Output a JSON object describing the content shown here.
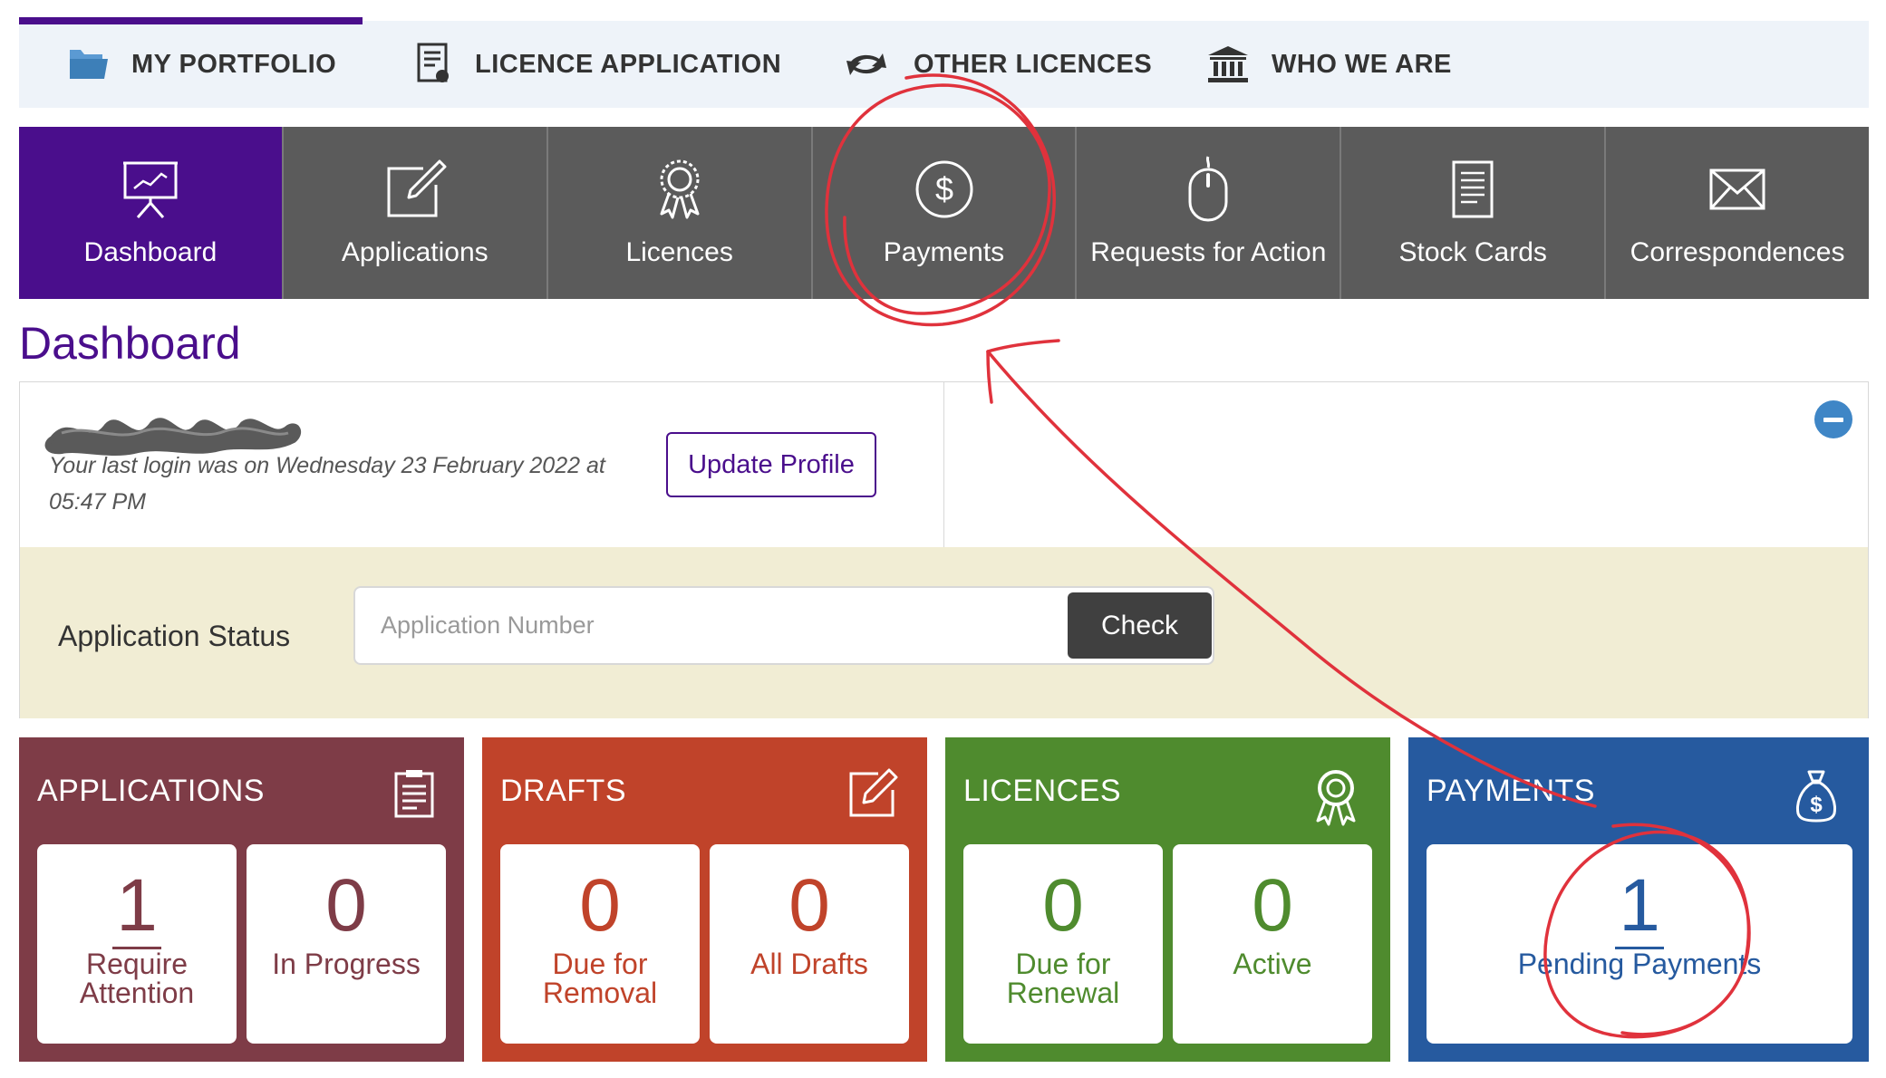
{
  "topnav": {
    "items": [
      {
        "label": "MY PORTFOLIO",
        "icon": "folder-icon"
      },
      {
        "label": "LICENCE APPLICATION",
        "icon": "document-icon"
      },
      {
        "label": "OTHER LICENCES",
        "icon": "arrows-icon"
      },
      {
        "label": "WHO WE ARE",
        "icon": "institution-icon"
      }
    ]
  },
  "tiles": [
    {
      "label": "Dashboard",
      "icon": "presentation-icon",
      "active": true
    },
    {
      "label": "Applications",
      "icon": "edit-icon"
    },
    {
      "label": "Licences",
      "icon": "award-icon"
    },
    {
      "label": "Payments",
      "icon": "dollar-icon"
    },
    {
      "label": "Requests for Action",
      "icon": "mouse-icon"
    },
    {
      "label": "Stock Cards",
      "icon": "list-document-icon"
    },
    {
      "label": "Correspondences",
      "icon": "envelope-icon"
    }
  ],
  "page": {
    "title": "Dashboard"
  },
  "profile": {
    "last_login": "Your last login was on Wednesday 23 February 2022 at 05:47 PM",
    "update_label": "Update Profile"
  },
  "status": {
    "label": "Application Status",
    "placeholder": "Application Number",
    "check_label": "Check"
  },
  "cards": {
    "applications": {
      "title": "APPLICATIONS",
      "stats": [
        {
          "value": "1",
          "label": "Require Attention"
        },
        {
          "value": "0",
          "label": "In Progress"
        }
      ]
    },
    "drafts": {
      "title": "DRAFTS",
      "stats": [
        {
          "value": "0",
          "label": "Due for Removal"
        },
        {
          "value": "0",
          "label": "All Drafts"
        }
      ]
    },
    "licences": {
      "title": "LICENCES",
      "stats": [
        {
          "value": "0",
          "label": "Due for Renewal"
        },
        {
          "value": "0",
          "label": "Active"
        }
      ]
    },
    "payments": {
      "title": "PAYMENTS",
      "stats": [
        {
          "value": "1",
          "label": "Pending Payments"
        }
      ]
    }
  },
  "colors": {
    "brand_purple": "#4a0e8c",
    "tile_grey": "#5b5b5b",
    "applications": "#7e3c47",
    "drafts": "#c0432a",
    "licences": "#4f8b2e",
    "payments": "#265a9f",
    "annotation_red": "#e0323c"
  }
}
